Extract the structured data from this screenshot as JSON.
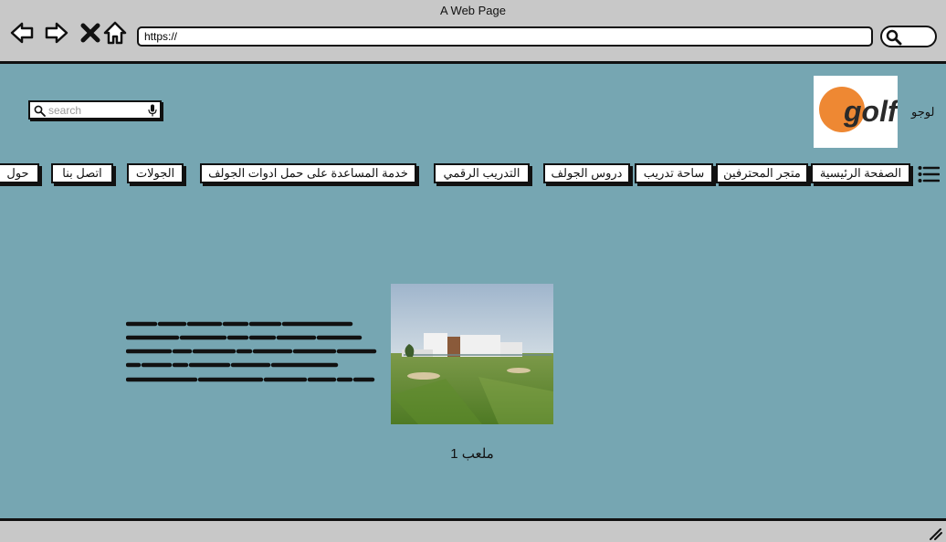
{
  "window": {
    "title": "A Web Page"
  },
  "browser": {
    "back_icon": "back-arrow-icon",
    "forward_icon": "forward-arrow-icon",
    "close_icon": "close-x-icon",
    "home_icon": "home-icon",
    "url": "https://",
    "search_icon": "search-icon"
  },
  "site": {
    "search_placeholder": "search",
    "logo_label": "لوجو",
    "logo_text": "golf",
    "nav": [
      "الصفحة الرئيسية",
      "متجر المحترفين",
      "ساحة تدريب",
      "دروس الجولف",
      "التدريب الرقمي",
      "خدمة المساعدة على حمل ادوات الجولف",
      "الجولات",
      "اتصل بنا",
      "حول"
    ],
    "content": {
      "caption": "ملعب 1"
    }
  },
  "colors": {
    "page_bg": "#76a6b2",
    "chrome_bg": "#c8c8c8",
    "logo_orange": "#ee8833"
  }
}
